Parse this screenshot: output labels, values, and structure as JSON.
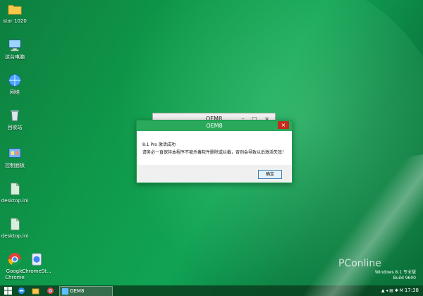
{
  "desktop": {
    "icons": [
      {
        "label": "star 1020",
        "icon": "folder-icon"
      },
      {
        "label": "这台电脑",
        "icon": "computer-icon"
      },
      {
        "label": "网络",
        "icon": "network-icon"
      },
      {
        "label": "回收站",
        "icon": "recycle-bin-icon"
      },
      {
        "label": "控制面板",
        "icon": "control-panel-icon"
      },
      {
        "label": "desktop.ini",
        "icon": "file-icon"
      },
      {
        "label": "desktop.ini",
        "icon": "file-icon"
      },
      {
        "label": "Google Chrome",
        "icon": "chrome-icon"
      },
      {
        "label": "ChromeSt...",
        "icon": "app-icon"
      }
    ]
  },
  "background_window": {
    "title": "OEM8",
    "controls": "– ▢ ×"
  },
  "dialog": {
    "title": "OEM8",
    "close": "×",
    "line1": "8.1 Pro 激活成功",
    "line2": "请务必一直保持本程序不被杀毒软件删除或拦截，否则会导致以后激活失效！",
    "ok": "确定"
  },
  "taskbar": {
    "task_label": "OEM8",
    "tray": "▲ ◂ ▤ ✱ M",
    "clock": "17:38"
  },
  "windows_info": {
    "line1": "Windows 8.1 专业版",
    "line2": "Build 9600"
  },
  "watermark": "PConline"
}
